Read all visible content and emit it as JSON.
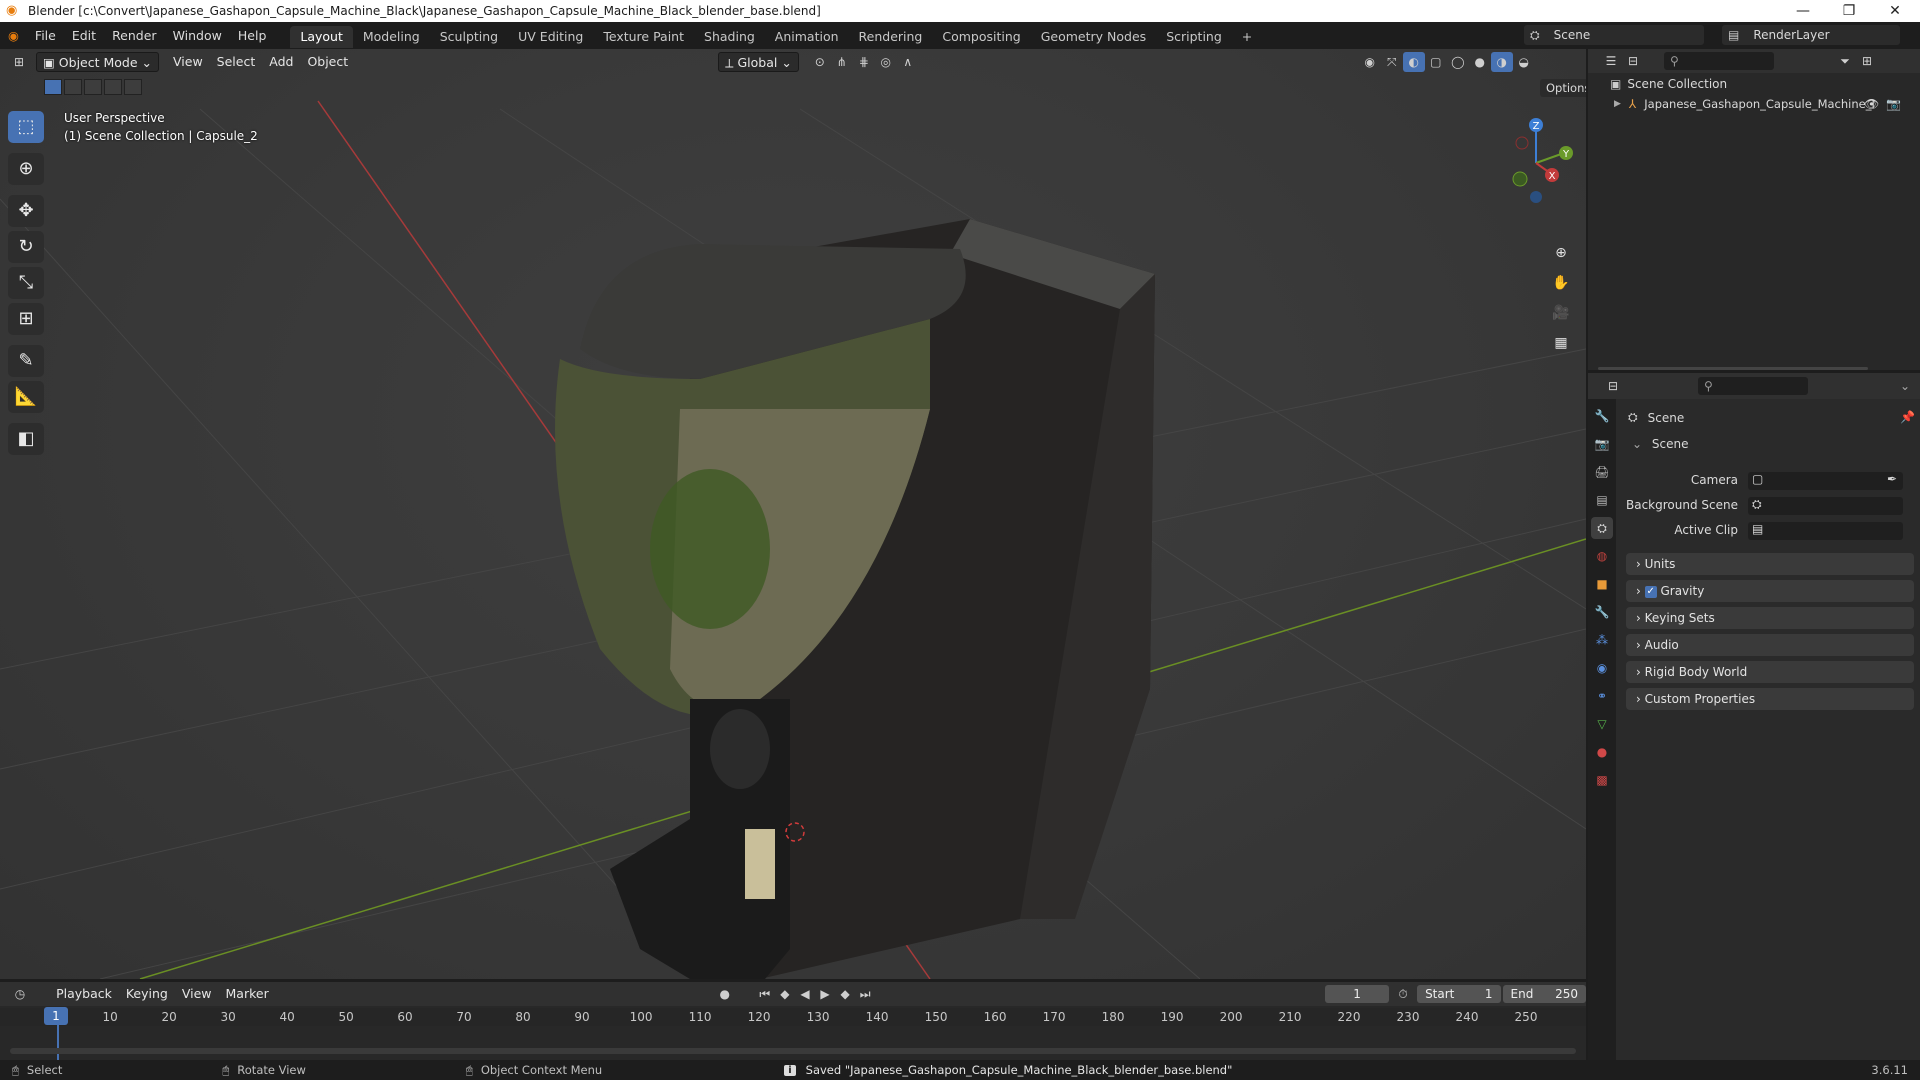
{
  "window": {
    "title": "Blender [c:\\Convert\\Japanese_Gashapon_Capsule_Machine_Black\\Japanese_Gashapon_Capsule_Machine_Black_blender_base.blend]",
    "minimize": "—",
    "maximize": "❐",
    "close": "✕"
  },
  "menu": [
    "File",
    "Edit",
    "Render",
    "Window",
    "Help"
  ],
  "workspaces": [
    "Layout",
    "Modeling",
    "Sculpting",
    "UV Editing",
    "Texture Paint",
    "Shading",
    "Animation",
    "Rendering",
    "Compositing",
    "Geometry Nodes",
    "Scripting"
  ],
  "active_workspace": "Layout",
  "add_workspace": "+",
  "scene_selector": {
    "label": "Scene",
    "layer": "RenderLayer"
  },
  "viewport_header": {
    "mode": "Object Mode",
    "menus": [
      "View",
      "Select",
      "Add",
      "Object"
    ],
    "orientation": "Global",
    "options": "Options"
  },
  "viewport": {
    "perspective": "User Perspective",
    "context": "(1) Scene Collection | Capsule_2"
  },
  "gizmo": {
    "z": "Z",
    "y": "Y",
    "x": "X"
  },
  "outliner": {
    "root": "Scene Collection",
    "items": [
      {
        "label": "Japanese_Gashapon_Capsule_Machine_I"
      }
    ]
  },
  "properties": {
    "header": "Scene",
    "section": "Scene",
    "fields": [
      {
        "label": "Camera"
      },
      {
        "label": "Background Scene"
      },
      {
        "label": "Active Clip"
      }
    ],
    "panels": [
      "Units",
      "Gravity",
      "Keying Sets",
      "Audio",
      "Rigid Body World",
      "Custom Properties"
    ],
    "gravity_checked": true
  },
  "timeline": {
    "menus": [
      "Playback",
      "Keying",
      "View",
      "Marker"
    ],
    "current_frame": "1",
    "start_label": "Start",
    "start": "1",
    "end_label": "End",
    "end": "250",
    "ticks": [
      "1",
      "10",
      "20",
      "30",
      "40",
      "50",
      "60",
      "70",
      "80",
      "90",
      "100",
      "110",
      "120",
      "130",
      "140",
      "150",
      "160",
      "170",
      "180",
      "190",
      "200",
      "210",
      "220",
      "230",
      "240",
      "250"
    ]
  },
  "status": {
    "select": "Select",
    "rotate": "Rotate View",
    "context_menu": "Object Context Menu",
    "message": "Saved \"Japanese_Gashapon_Capsule_Machine_Black_blender_base.blend\"",
    "version": "3.6.11"
  },
  "colors": {
    "accent": "#4772b3",
    "x_axis": "#c23b3b",
    "y_axis": "#6a9a2a",
    "z_axis": "#3d7fd6"
  }
}
